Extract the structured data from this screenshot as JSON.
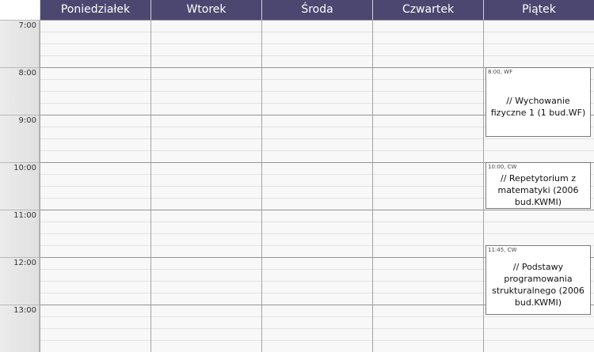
{
  "days": [
    "Poniedziałek",
    "Wtorek",
    "Środa",
    "Czwartek",
    "Piątek"
  ],
  "hours": [
    "7:00",
    "8:00",
    "9:00",
    "10:00",
    "11:00",
    "12:00",
    "13:00"
  ],
  "events": [
    {
      "day": "Piątek",
      "meta": "8:00, WF",
      "title": "// Wychowanie fizyczne 1 (1 bud.WF)"
    },
    {
      "day": "Piątek",
      "meta": "10:00, CW",
      "title": "// Repetytorium z matematyki (2006 bud.KWMI)"
    },
    {
      "day": "Piątek",
      "meta": "11:45, CW",
      "title": "// Podstawy programowania strukturalnego (2006 bud.KWMI)"
    }
  ]
}
